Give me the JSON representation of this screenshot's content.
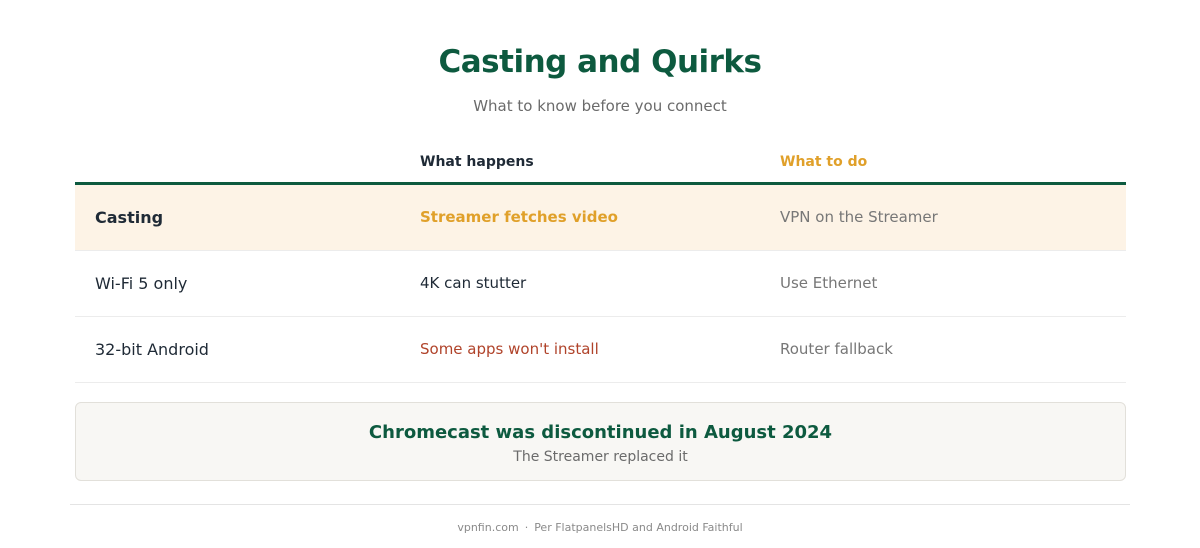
{
  "header": {
    "title": "Casting and Quirks",
    "subtitle": "What to know before you connect"
  },
  "table": {
    "columns": [
      "",
      "What happens",
      "What to do"
    ],
    "rows": [
      {
        "label": "Casting",
        "happens": "Streamer fetches video",
        "todo": "VPN on the Streamer"
      },
      {
        "label": "Wi-Fi 5 only",
        "happens": "4K can stutter",
        "todo": "Use Ethernet"
      },
      {
        "label": "32-bit Android",
        "happens": "Some apps won't install",
        "todo": "Router fallback"
      }
    ]
  },
  "note": {
    "title": "Chromecast was discontinued in August 2024",
    "subtitle": "The Streamer replaced it"
  },
  "footer": {
    "site": "vpnfin.com",
    "separator": "·",
    "source": "Per FlatpanelsHD and Android Faithful"
  },
  "colors": {
    "brand_green": "#0d5a3f",
    "accent_orange": "#e0a02a",
    "highlight_bg": "#fdf3e6",
    "warning_red": "#b0432a"
  }
}
